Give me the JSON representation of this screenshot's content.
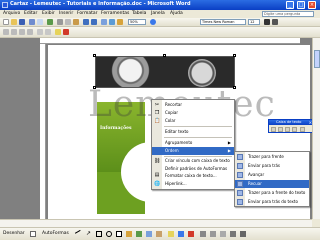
{
  "window": {
    "title": "Cartaz - Lemeutec - Tutoriais e Informação.doc - Microsoft Word",
    "minimize": "_",
    "maximize": "□",
    "close": "×"
  },
  "menubar": {
    "items": [
      "Arquivo",
      "Editar",
      "Exibir",
      "Inserir",
      "Formatar",
      "Ferramentas",
      "Tabela",
      "Janela",
      "Ajuda"
    ],
    "help_placeholder": "Digite uma pergunta"
  },
  "toolbar": {
    "zoom": "50%",
    "font_name": "Times New Roman",
    "font_size": "12"
  },
  "document": {
    "watermark": "Lemeutec",
    "panel_title": "Informações"
  },
  "textbox_toolbar": {
    "title": "Caixa de texto",
    "close": "×"
  },
  "context_menu": {
    "items": [
      {
        "label": "Recortar",
        "icon": "✂"
      },
      {
        "label": "Copiar",
        "icon": "❐"
      },
      {
        "label": "Colar",
        "icon": "📋"
      },
      {
        "label": "Editar texto",
        "icon": ""
      },
      {
        "label": "Agrupamento",
        "icon": "",
        "submenu": true
      },
      {
        "label": "Ordem",
        "icon": "",
        "submenu": true,
        "highlighted": true
      },
      {
        "label": "Criar vínculo com caixa de texto",
        "icon": "⛓"
      },
      {
        "label": "Definir padrões de AutoFormas",
        "icon": ""
      },
      {
        "label": "Formatar caixa de texto...",
        "icon": "▤"
      },
      {
        "label": "Hiperlink...",
        "icon": "🌐"
      }
    ]
  },
  "order_submenu": {
    "items": [
      {
        "label": "Trazer para frente"
      },
      {
        "label": "Enviar para trás"
      },
      {
        "label": "Avançar"
      },
      {
        "label": "Recuar",
        "highlighted": true
      },
      {
        "label": "Trazer para a frente do texto"
      },
      {
        "label": "Enviar para trás do texto"
      }
    ]
  },
  "drawing_bar": {
    "draw_label": "Desenhar",
    "autoshapes_label": "AutoFormas"
  }
}
